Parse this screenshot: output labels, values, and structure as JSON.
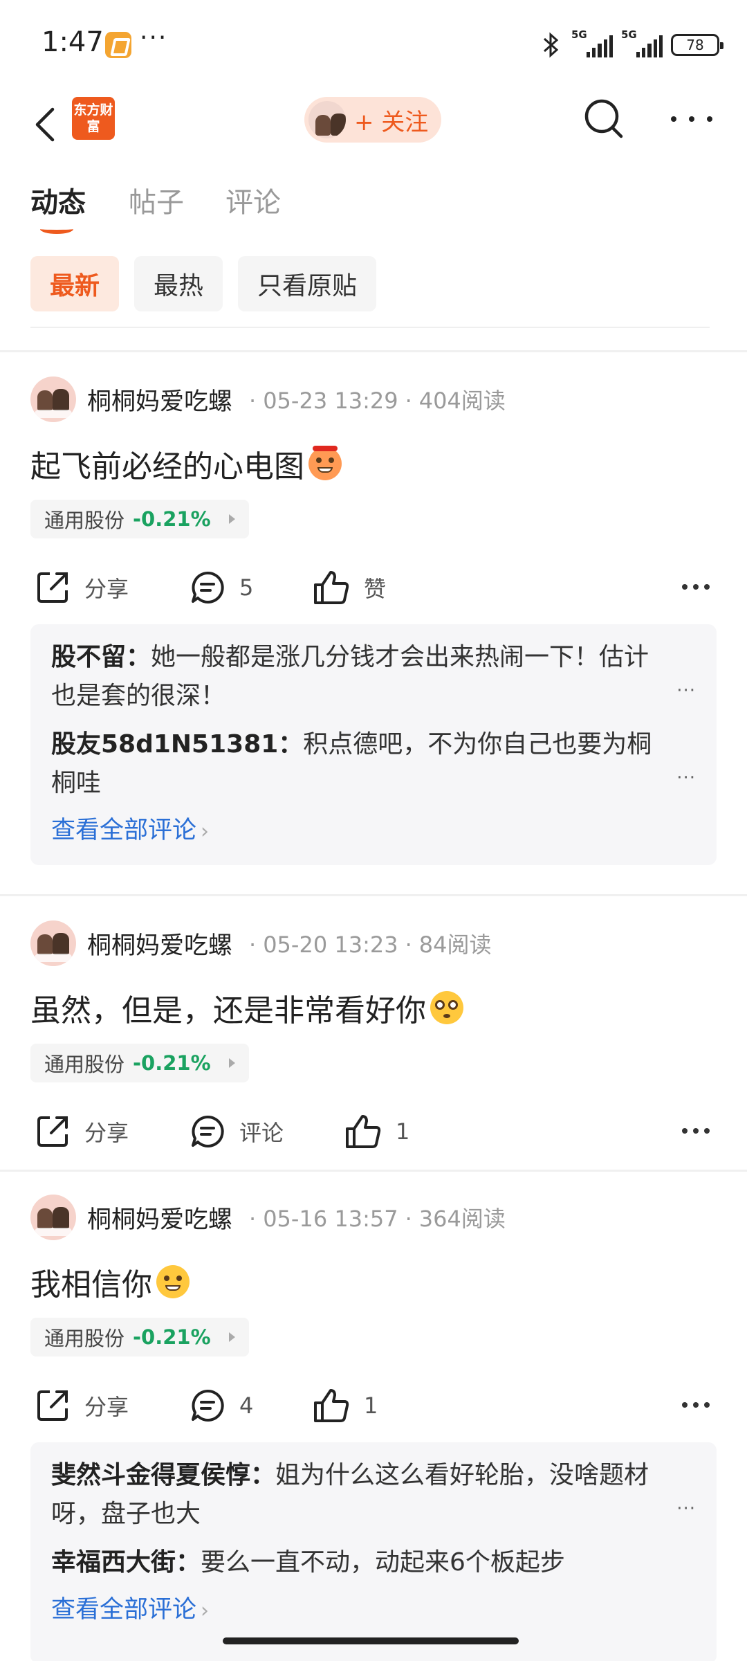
{
  "status_bar": {
    "time": "1:47",
    "dots": "···",
    "signal1": "5G",
    "signal2": "5G",
    "battery": "78"
  },
  "nav": {
    "logo_text": "东方财富",
    "follow_label": "+ 关注"
  },
  "tabs": [
    {
      "label": "动态"
    },
    {
      "label": "帖子"
    },
    {
      "label": "评论"
    }
  ],
  "filters": [
    {
      "label": "最新"
    },
    {
      "label": "最热"
    },
    {
      "label": "只看原贴"
    }
  ],
  "posts": [
    {
      "author": "桐桐妈爱吃螺",
      "date": "05-23 13:29",
      "reads": "404阅读",
      "text": "起飞前必经的心电图",
      "stock": {
        "name": "通用股份",
        "change": "-0.21%"
      },
      "share_label": "分享",
      "comment_label": "5",
      "like_label": "赞",
      "comments": [
        {
          "user": "股不留：",
          "text": "她一般都是涨几分钱才会出来热闹一下！估计也是套的很深！"
        },
        {
          "user": "股友58d1N51381：",
          "text": "积点德吧，不为你自己也要为桐桐哇"
        }
      ],
      "view_all": "查看全部评论"
    },
    {
      "author": "桐桐妈爱吃螺",
      "date": "05-20 13:23",
      "reads": "84阅读",
      "text": "虽然，但是，还是非常看好你",
      "stock": {
        "name": "通用股份",
        "change": "-0.21%"
      },
      "share_label": "分享",
      "comment_label": "评论",
      "like_label": "1"
    },
    {
      "author": "桐桐妈爱吃螺",
      "date": "05-16 13:57",
      "reads": "364阅读",
      "text": "我相信你",
      "stock": {
        "name": "通用股份",
        "change": "-0.21%"
      },
      "share_label": "分享",
      "comment_label": "4",
      "like_label": "1",
      "comments": [
        {
          "user": "斐然斗金得夏侯惇：",
          "text": "姐为什么这么看好轮胎，没啥题材呀，盘子也大"
        },
        {
          "user": "幸福西大街：",
          "text": "要么一直不动，动起来6个板起步"
        }
      ],
      "view_all": "查看全部评论"
    }
  ],
  "colors": {
    "accent": "#ee5a1e",
    "down": "#1aa260",
    "link": "#2a6fd6"
  }
}
